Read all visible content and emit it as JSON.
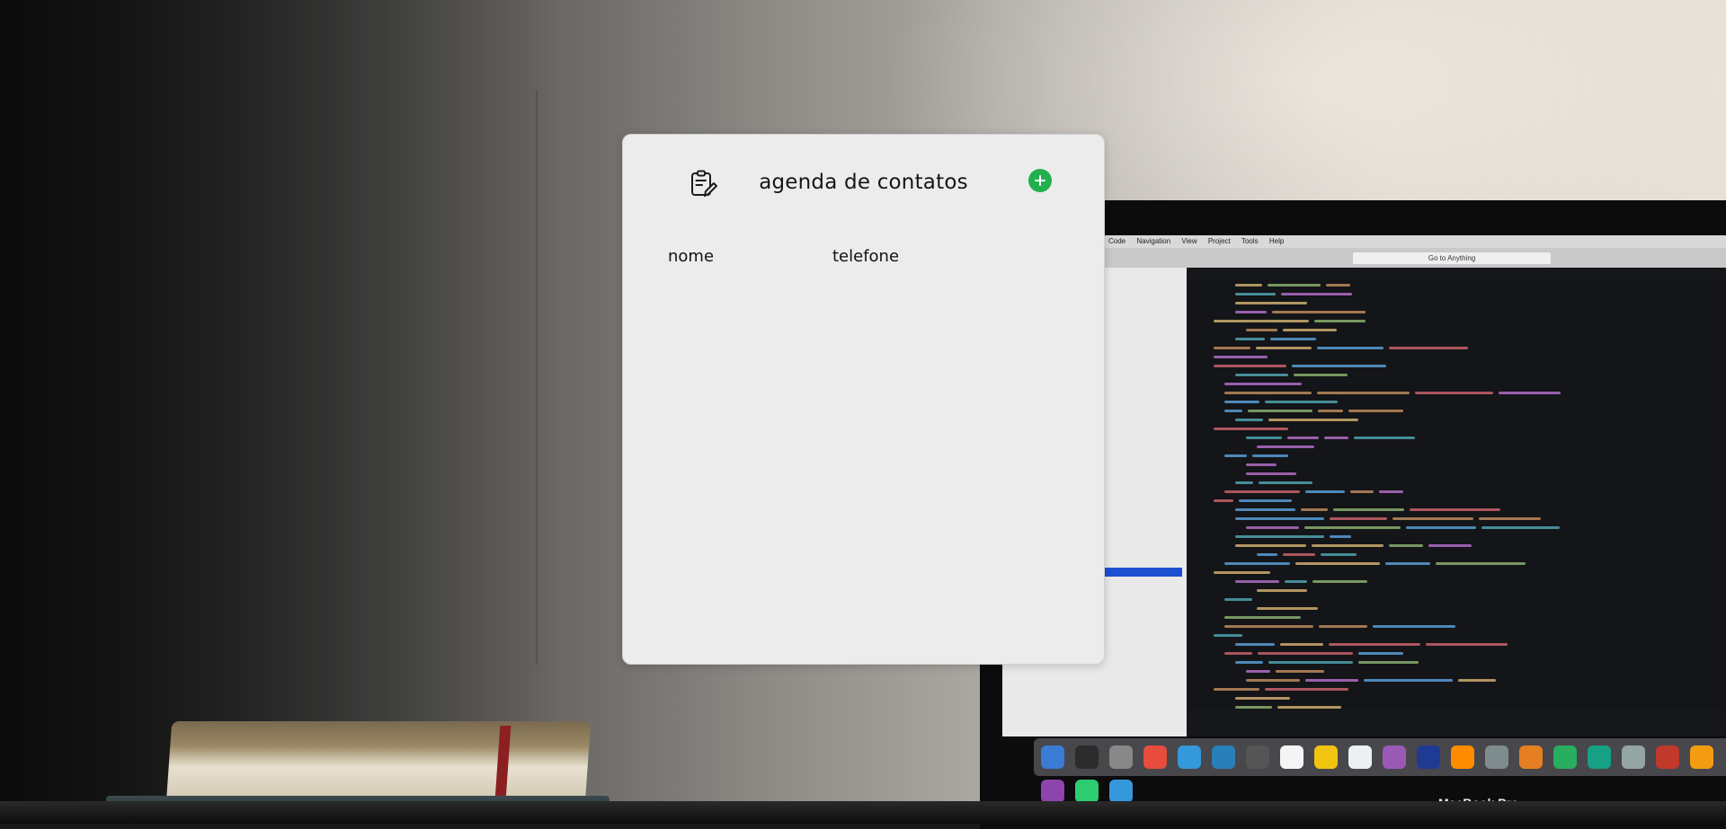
{
  "app": {
    "title": "agenda de contatos",
    "add_button_icon": "plus-circle-icon",
    "header_icon": "notepad-edit-icon",
    "accent_color": "#21b04b"
  },
  "table": {
    "columns": [
      "nome",
      "telefone"
    ],
    "rows": []
  },
  "background_screen": {
    "menubar_items": [
      "Code",
      "Navigation",
      "View",
      "Project",
      "Tools",
      "Help"
    ],
    "goto_label": "Go to Anything",
    "brand": "MacBook Pro"
  }
}
